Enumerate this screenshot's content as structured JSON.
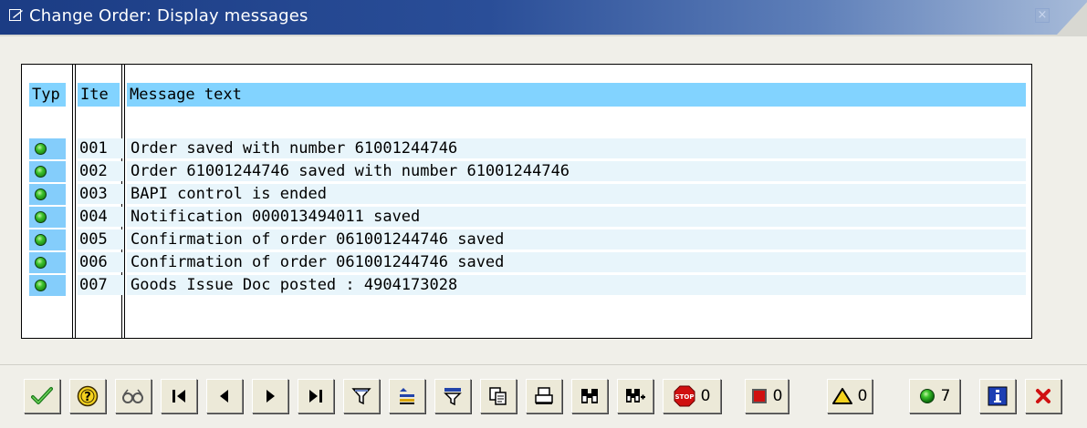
{
  "window": {
    "title": "Change Order: Display messages"
  },
  "table": {
    "headers": {
      "type": "Typ",
      "item": "Ite",
      "text": "Message text"
    },
    "rows": [
      {
        "status": "green",
        "item": "001",
        "text": "Order saved with number 61001244746"
      },
      {
        "status": "green",
        "item": "002",
        "text": "Order 61001244746 saved with number 61001244746"
      },
      {
        "status": "green",
        "item": "003",
        "text": "BAPI control is ended"
      },
      {
        "status": "green",
        "item": "004",
        "text": "Notification 000013494011 saved"
      },
      {
        "status": "green",
        "item": "005",
        "text": "Confirmation of order 061001244746 saved"
      },
      {
        "status": "green",
        "item": "006",
        "text": "Confirmation of order 061001244746 saved"
      },
      {
        "status": "green",
        "item": "007",
        "text": "Goods Issue Doc posted : 4904173028"
      }
    ]
  },
  "toolbar": {
    "counts": {
      "stop": "0",
      "error": "0",
      "warning": "0",
      "success": "7"
    },
    "icons": [
      "continue-check-icon",
      "help-icon",
      "technical-info-icon",
      "first-page-icon",
      "previous-page-icon",
      "next-page-icon",
      "last-page-icon",
      "filter-icon",
      "sort-icon",
      "set-filter-icon",
      "copy-icon",
      "print-icon",
      "find-icon",
      "find-next-icon",
      "stop-icon",
      "error-icon",
      "warning-icon",
      "success-icon",
      "info-icon",
      "cancel-icon"
    ]
  },
  "colors": {
    "header_accent": "#82d3ff",
    "row_bg": "#e8f5fb",
    "title_gradient_start": "#1b3c84",
    "success_green": "#3cc22c"
  }
}
